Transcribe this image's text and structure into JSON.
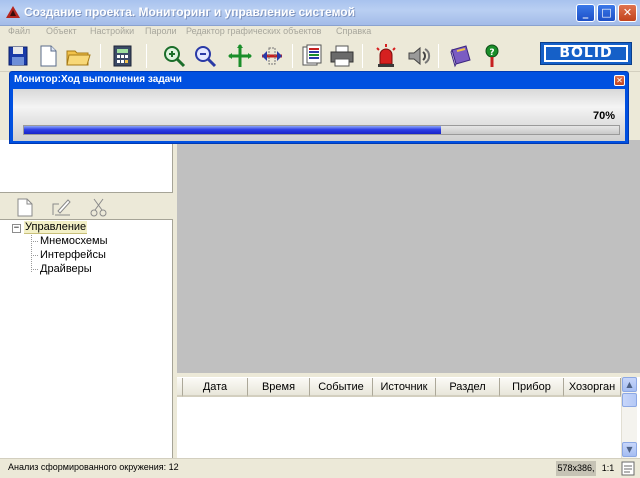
{
  "window": {
    "title": "Создание проекта. Мониторинг и управление системой",
    "controls": {
      "minimize": "_",
      "maximize": "□",
      "close": "✕"
    }
  },
  "menu": [
    "Файл",
    "Объект",
    "Настройки",
    "Пароли",
    "Редактор графических объектов",
    "Справка"
  ],
  "toolbar": {
    "buttons": [
      "save-icon",
      "new-document-icon",
      "open-folder-icon",
      "calculator-icon",
      "zoom-in-icon",
      "zoom-out-icon",
      "zoom-fit-icon",
      "zoom-selection-icon",
      "documents-icon",
      "printer-icon",
      "alarm-siren-icon",
      "speaker-icon",
      "book-icon",
      "help-pin-icon"
    ],
    "brand": "BOLID"
  },
  "progress_dialog": {
    "title": "Монитор:Ход выполнения задачи",
    "percent_label": "70%",
    "progress": 0.7,
    "close": "✕"
  },
  "tree_toolbar": [
    "new-item-icon",
    "edit-item-icon",
    "delete-item-icon"
  ],
  "tree": {
    "root": {
      "toggle": "−",
      "label": "Управление"
    },
    "children": [
      "Мнемосхемы",
      "Интерфейсы",
      "Драйверы"
    ]
  },
  "table": {
    "columns": [
      "Дата",
      "Время",
      "Событие",
      "Источник",
      "Раздел",
      "Прибор",
      "Хозорган"
    ]
  },
  "status": {
    "text": "Анализ сформированного окружения: 12",
    "canvas_size": "578x386,",
    "zoom": "1:1"
  },
  "colors": {
    "title_gradient": "#a8c2ee",
    "dialog_title": "#0050e0",
    "workspace": "#c0c0c0",
    "progress_fill": "#1823c8",
    "brand_blue": "#1560c8"
  }
}
